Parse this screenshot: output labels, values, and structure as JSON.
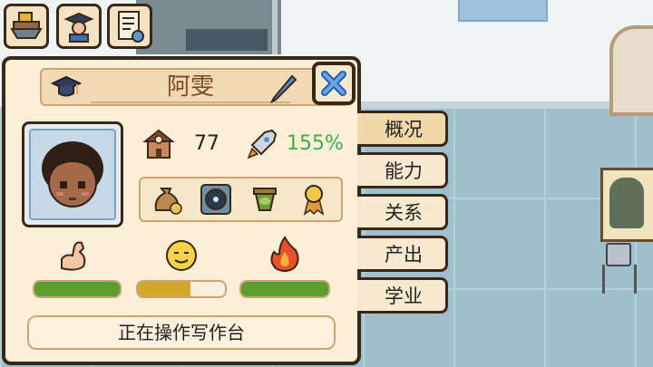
{
  "character": {
    "name": "阿雯",
    "level": "77",
    "efficiency": "155%",
    "status": "正在操作写作台"
  },
  "bars": {
    "strength": 1.0,
    "mood": 0.6,
    "energy": 1.0
  },
  "tabs": [
    "概况",
    "能力",
    "关系",
    "产出",
    "学业"
  ],
  "colors": {
    "efficiency_text": "#3fae4a",
    "bar_green": "#5a9e2f",
    "bar_gold": "#d4a62a",
    "panel_border": "#3a2718"
  },
  "icons": {
    "top_buttons": [
      "ship-icon",
      "graduate-icon",
      "document-icon"
    ],
    "items": [
      "money-bag-icon",
      "vinyl-record-icon",
      "pot-icon",
      "medal-icon"
    ]
  }
}
